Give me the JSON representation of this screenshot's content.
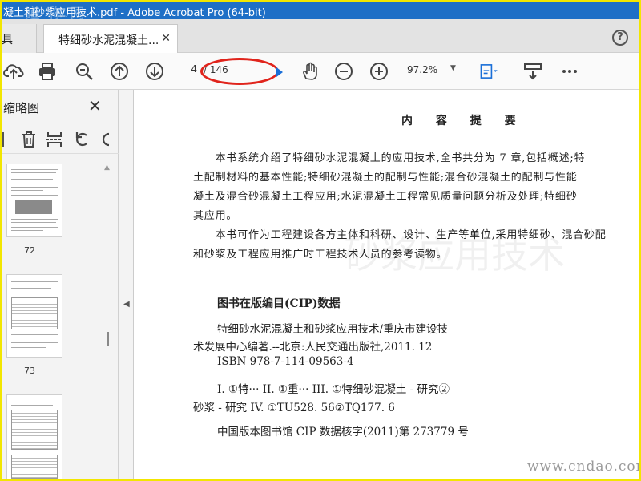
{
  "window": {
    "title": "凝土和砂浆应用技术.pdf - Adobe Acrobat Pro (64-bit)",
    "title_watermark": "道 称 网"
  },
  "tabs": {
    "tools_label": "具",
    "doc_label": "特细砂水泥混凝土...",
    "close_glyph": "✕",
    "help_glyph": "?"
  },
  "toolbar": {
    "page_current": "4",
    "page_total": "/ 146",
    "zoom": "97.2%",
    "zoom_caret": "▼",
    "icons": [
      "upload-cloud-icon",
      "print-icon",
      "zoom-search-icon",
      "page-up-icon",
      "page-down-icon",
      "hand-tool-icon",
      "zoom-out-icon",
      "zoom-in-icon",
      "fit-page-icon",
      "scroll-mode-icon",
      "more-icon"
    ],
    "highlight_color": "#e0241c"
  },
  "sidebar": {
    "title": "缩略图",
    "close_glyph": "✕",
    "thumbnails": [
      {
        "label": "72"
      },
      {
        "label": "73"
      },
      {
        "label": ""
      }
    ],
    "collapse_glyph": "◀"
  },
  "document": {
    "heading": "内 容 提 要",
    "paragraphs": [
      "　　本书系统介绍了特细砂水泥混凝土的应用技术,全书共分为 7 章,包括概述;特",
      "土配制材料的基本性能;特细砂混凝土的配制与性能;混合砂混凝土的配制与性能",
      "凝土及混合砂混凝土工程应用;水泥混凝土工程常见质量问题分析及处理;特细砂",
      "其应用。",
      "　　本书可作为工程建设各方主体和科研、设计、生产等单位,采用特细砂、混合砂配",
      "和砂浆及工程应用推广时工程技术人员的参考读物。"
    ],
    "cip_title": "图书在版编目(CIP)数据",
    "cip_lines": [
      "特细砂水泥混凝土和砂浆应用技术/重庆市建设技",
      "术发展中心编著.--北京:人民交通出版社,2011. 12",
      "ISBN  978-7-114-09563-4",
      "I. ①特···   II. ①重···   III. ①特细砂混凝土 - 研究②",
      "砂浆 - 研究   IV. ①TU528. 56②TQ177. 6",
      "中国版本图书馆 CIP 数据核字(2011)第 273779 号"
    ],
    "ghost_text": "砂浆应用技术"
  },
  "watermark": "www.cndao.com",
  "colors": {
    "titlebar": "#1e6fc6",
    "frame": "#f2e600",
    "accent_blue": "#1a6fd8"
  }
}
